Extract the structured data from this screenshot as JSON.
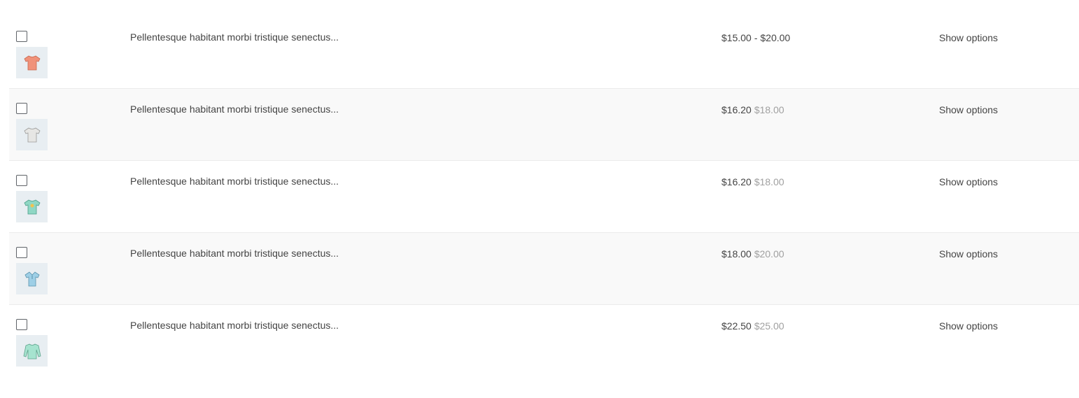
{
  "products": [
    {
      "title": "Pellentesque habitant morbi tristique senectus...",
      "price_from": "$15.00",
      "price_sep": "-",
      "price_to": "$20.00",
      "action_label": "Show options",
      "thumb_color": "#f0927a",
      "thumb_icon": "tshirt-icon"
    },
    {
      "title": "Pellentesque habitant morbi tristique senectus...",
      "price_sale": "$16.20",
      "price_regular": "$18.00",
      "action_label": "Show options",
      "thumb_color": "#e6e6e4",
      "thumb_icon": "tshirt-icon"
    },
    {
      "title": "Pellentesque habitant morbi tristique senectus...",
      "price_sale": "$16.20",
      "price_regular": "$18.00",
      "action_label": "Show options",
      "thumb_color": "#8fd7c4",
      "thumb_icon": "tshirt-icon"
    },
    {
      "title": "Pellentesque habitant morbi tristique senectus...",
      "price_sale": "$18.00",
      "price_regular": "$20.00",
      "action_label": "Show options",
      "thumb_color": "#9ecfe6",
      "thumb_icon": "polo-shirt-icon"
    },
    {
      "title": "Pellentesque habitant morbi tristique senectus...",
      "price_sale": "$22.50",
      "price_regular": "$25.00",
      "action_label": "Show options",
      "thumb_color": "#a6e3cf",
      "thumb_icon": "long-sleeve-shirt-icon"
    }
  ]
}
